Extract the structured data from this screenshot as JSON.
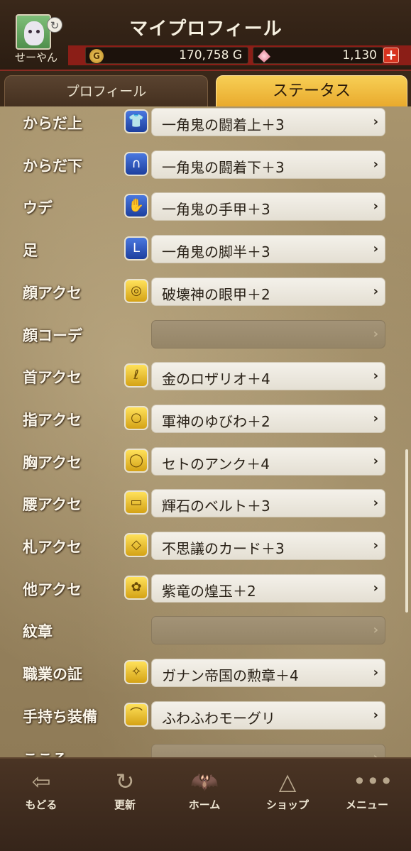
{
  "header": {
    "title": "マイプロフィール",
    "username": "せーやん",
    "gold_icon_text": "G",
    "gold": "170,758 G",
    "gems": "1,130",
    "plus_label": "+"
  },
  "tabs": [
    {
      "label": "プロフィール",
      "active": false
    },
    {
      "label": "ステータス",
      "active": true
    }
  ],
  "equipment": [
    {
      "slot": "からだ上",
      "icon": "body-upper-armor-icon",
      "icon_color": "blue",
      "glyph": "👕",
      "item": "一角鬼の闘着上＋3"
    },
    {
      "slot": "からだ下",
      "icon": "body-lower-armor-icon",
      "icon_color": "blue",
      "glyph": "∩",
      "item": "一角鬼の闘着下＋3"
    },
    {
      "slot": "ウデ",
      "icon": "gauntlet-icon",
      "icon_color": "blue",
      "glyph": "✋",
      "item": "一角鬼の手甲＋3"
    },
    {
      "slot": "足",
      "icon": "boots-icon",
      "icon_color": "blue",
      "glyph": "L",
      "item": "一角鬼の脚半＋3"
    },
    {
      "slot": "顔アクセ",
      "icon": "face-accessory-icon",
      "icon_color": "gold",
      "glyph": "◎",
      "item": "破壊神の眼甲＋2"
    },
    {
      "slot": "顔コーデ",
      "icon": "",
      "icon_color": "",
      "glyph": "",
      "item": ""
    },
    {
      "slot": "首アクセ",
      "icon": "necklace-icon",
      "icon_color": "gold",
      "glyph": "ℓ",
      "item": "金のロザリオ＋4"
    },
    {
      "slot": "指アクセ",
      "icon": "ring-icon",
      "icon_color": "gold",
      "glyph": "○",
      "item": "軍神のゆびわ＋2"
    },
    {
      "slot": "胸アクセ",
      "icon": "chest-accessory-icon",
      "icon_color": "gold",
      "glyph": "◯",
      "item": "セトのアンク＋4"
    },
    {
      "slot": "腰アクセ",
      "icon": "belt-icon",
      "icon_color": "gold",
      "glyph": "▭",
      "item": "輝石のベルト＋3"
    },
    {
      "slot": "札アクセ",
      "icon": "card-icon",
      "icon_color": "gold",
      "glyph": "◇",
      "item": "不思議のカード＋3"
    },
    {
      "slot": "他アクセ",
      "icon": "other-accessory-icon",
      "icon_color": "gold",
      "glyph": "✿",
      "item": "紫竜の煌玉＋2"
    },
    {
      "slot": "紋章",
      "icon": "",
      "icon_color": "",
      "glyph": "",
      "item": ""
    },
    {
      "slot": "職業の証",
      "icon": "job-emblem-icon",
      "icon_color": "gold",
      "glyph": "✧",
      "item": "ガナン帝国の勲章＋4"
    },
    {
      "slot": "手持ち装備",
      "icon": "handheld-equipment-icon",
      "icon_color": "gold",
      "glyph": "⌒",
      "item": "ふわふわモーグリ"
    },
    {
      "slot": "こころ",
      "icon": "",
      "icon_color": "",
      "glyph": "",
      "item": ""
    }
  ],
  "chevron": "›",
  "nav": [
    {
      "label": "もどる",
      "icon": "back-arrow-icon",
      "glyph": "⇦"
    },
    {
      "label": "更新",
      "icon": "refresh-icon",
      "glyph": "↻"
    },
    {
      "label": "ホーム",
      "icon": "home-dracky-icon",
      "glyph": "🦇"
    },
    {
      "label": "ショップ",
      "icon": "shop-slime-icon",
      "glyph": "△"
    },
    {
      "label": "メニュー",
      "icon": "menu-dots-icon",
      "glyph": "•••"
    }
  ]
}
